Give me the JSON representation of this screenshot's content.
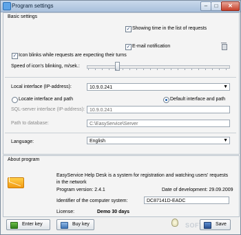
{
  "window": {
    "title": "Program settings",
    "close_glyph": "✕",
    "min_glyph": "–",
    "max_glyph": "□"
  },
  "basic": {
    "title": "Basic settings",
    "show_time": {
      "label": "Showing time in the list of requests",
      "checked": true
    },
    "email": {
      "label": "E-mail notification",
      "checked": true
    },
    "icon_blinks": {
      "label": "Icon blinks while requests are expecting their turns",
      "checked": true
    },
    "speed_label": "Speed of icon's blinking, m/sek.:",
    "speed_level": 0.2,
    "local_if_label": "Local interface (IP-address):",
    "local_if_value": "10.9.0.241",
    "locate_label": "Locate interface and path",
    "default_label": "Default interface and path",
    "sql_label": "SQL-server interface (IP-address):",
    "sql_value": "10.9.0.241",
    "path_label": "Path to database:",
    "path_value": "C:\\EasyService\\Server",
    "language_label": "Language:",
    "language_value": "English"
  },
  "about": {
    "title": "About program",
    "description": "EasyService Help Desk is a system for registration and watching users' requests in the network",
    "version": "Program version: 2.4.1",
    "dev_date": "Date of development: 29.09.2009",
    "identifier_label": "Identifier of the computer system:",
    "identifier_value": "DC87141D-EADC",
    "license_label": "License:",
    "license_value": "Demo 30 days"
  },
  "buttons": {
    "enter_key": "Enter key",
    "buy_key": "Buy key",
    "save": "Save"
  },
  "watermark": "SOFTPEDIA",
  "icons": {
    "mail": "mail-icon",
    "trash": "trash-icon",
    "bulb": "bulb-icon"
  }
}
